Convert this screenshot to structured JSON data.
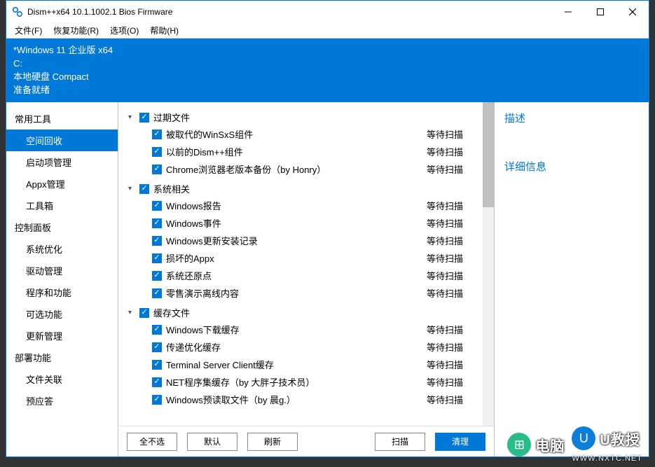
{
  "window": {
    "title": "Dism++x64 10.1.1002.1 Bios Firmware"
  },
  "menubar": {
    "file": "文件(F)",
    "recovery": "恢复功能(R)",
    "options": "选项(O)",
    "help": "帮助(H)"
  },
  "info": {
    "os": "*Windows 11 企业版 x64",
    "drive": "C:",
    "disk": "本地硬盘 Compact",
    "status": "准备就绪"
  },
  "sidebar": {
    "g1": "常用工具",
    "g1_items": [
      "空间回收",
      "启动项管理",
      "Appx管理",
      "工具箱"
    ],
    "g2": "控制面板",
    "g2_items": [
      "系统优化",
      "驱动管理",
      "程序和功能",
      "可选功能",
      "更新管理"
    ],
    "g3": "部署功能",
    "g3_items": [
      "文件关联",
      "预应答"
    ]
  },
  "tree": {
    "groups": [
      {
        "label": "过期文件",
        "items": [
          {
            "label": "被取代的WinSxS组件",
            "status": "等待扫描"
          },
          {
            "label": "以前的Dism++组件",
            "status": "等待扫描"
          },
          {
            "label": "Chrome浏览器老版本备份（by Honry）",
            "status": "等待扫描"
          }
        ]
      },
      {
        "label": "系统相关",
        "items": [
          {
            "label": "Windows报告",
            "status": "等待扫描"
          },
          {
            "label": "Windows事件",
            "status": "等待扫描"
          },
          {
            "label": "Windows更新安装记录",
            "status": "等待扫描"
          },
          {
            "label": "损坏的Appx",
            "status": "等待扫描"
          },
          {
            "label": "系统还原点",
            "status": "等待扫描"
          },
          {
            "label": "零售演示离线内容",
            "status": "等待扫描"
          }
        ]
      },
      {
        "label": "缓存文件",
        "items": [
          {
            "label": "Windows下载缓存",
            "status": "等待扫描"
          },
          {
            "label": "传递优化缓存",
            "status": "等待扫描"
          },
          {
            "label": "Terminal Server Client缓存",
            "status": "等待扫描"
          },
          {
            "label": "NET程序集缓存（by 大胖子技术员）",
            "status": "等待扫描"
          },
          {
            "label": "Windows预读取文件（by 晨g.）",
            "status": "等待扫描"
          }
        ]
      }
    ]
  },
  "buttons": {
    "select_none": "全不选",
    "default": "默认",
    "refresh": "刷新",
    "scan": "扫描",
    "clean": "清理"
  },
  "right": {
    "description": "描述",
    "details": "详细信息"
  },
  "watermark": {
    "text1": "电脑",
    "text2": "U教授",
    "url": "WWW.NXTC.NET"
  }
}
